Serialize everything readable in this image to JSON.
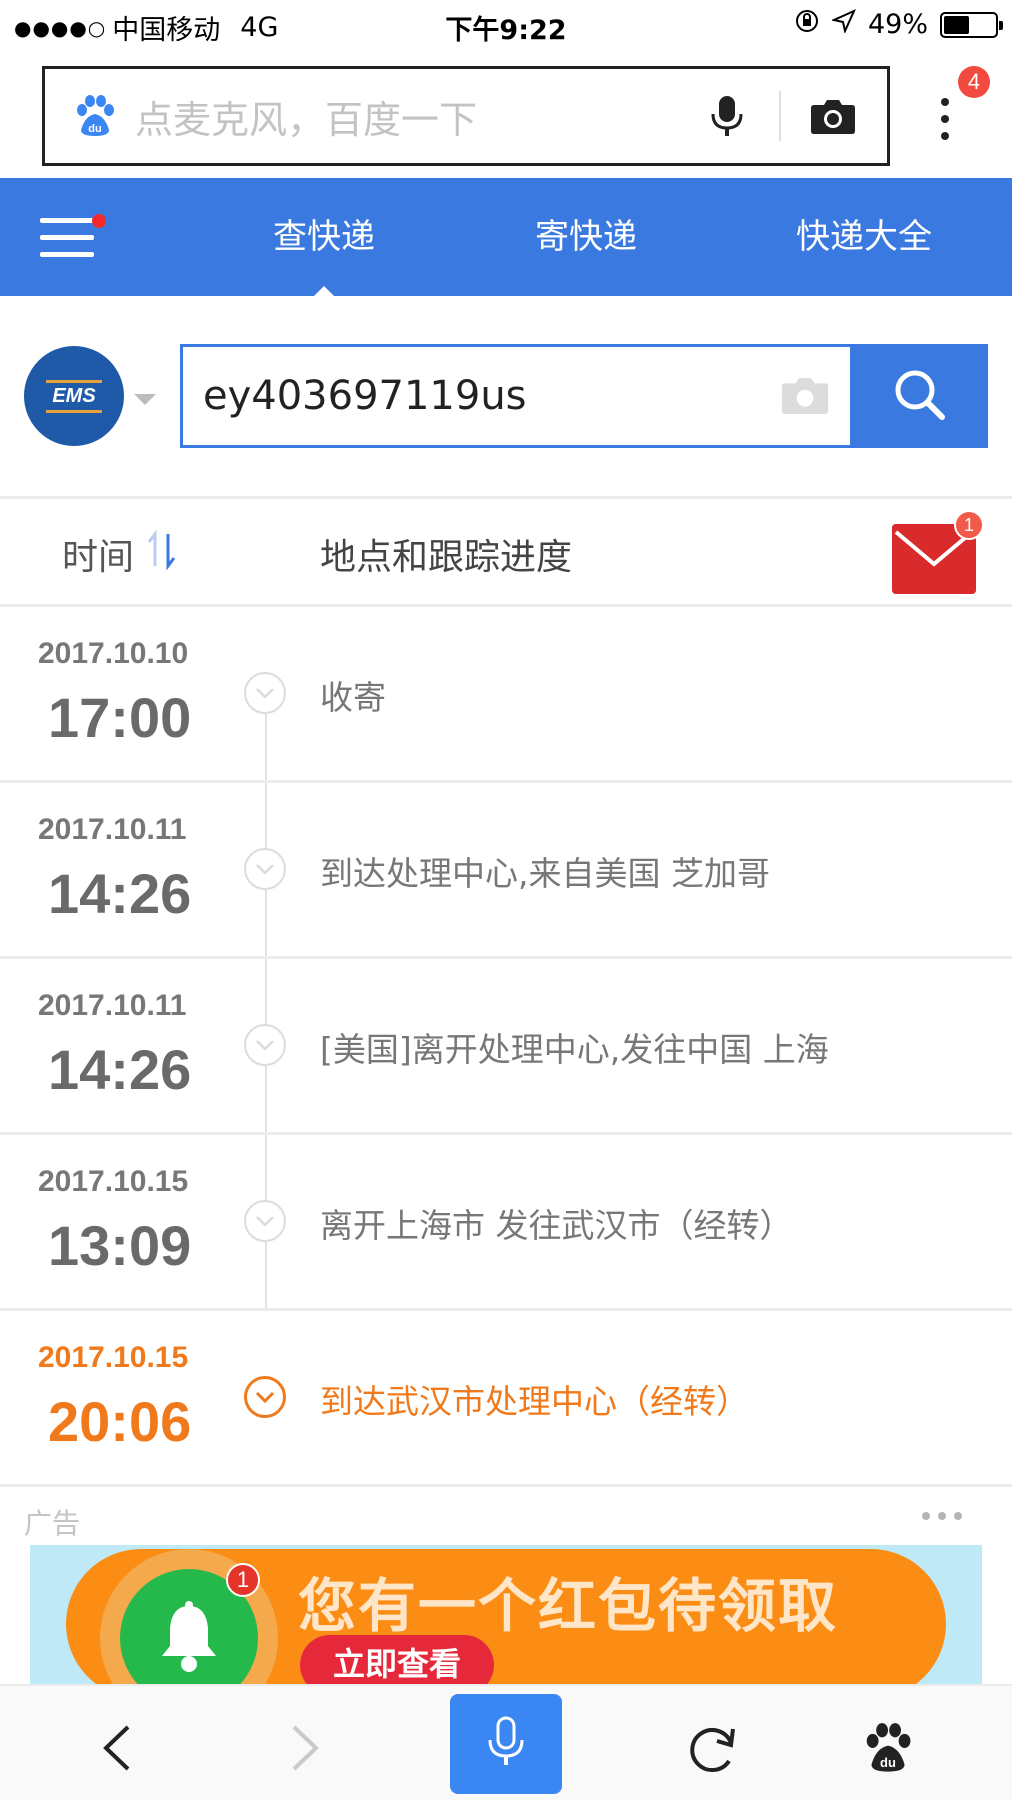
{
  "status_bar": {
    "signal": "●●●●○",
    "carrier": "中国移动",
    "network": "4G",
    "time": "下午9:22",
    "battery_text": "49%",
    "battery_level": 0.49
  },
  "baidu_bar": {
    "placeholder": "点麦克风，百度一下",
    "notification_count": "4",
    "icons": [
      "baidu-paw-icon",
      "microphone-icon",
      "camera-icon",
      "more-vertical-icon"
    ]
  },
  "nav": {
    "tabs": [
      {
        "label": "查快递",
        "active": true
      },
      {
        "label": "寄快递",
        "active": false
      },
      {
        "label": "快递大全",
        "active": false
      }
    ],
    "accent_color": "#3a7ae0"
  },
  "query": {
    "carrier_logo_text": "EMS",
    "tracking_number": "ey403697119us"
  },
  "table_header": {
    "time_label": "时间",
    "location_label": "地点和跟踪进度",
    "message_count": "1"
  },
  "events": [
    {
      "date": "2017.10.10",
      "time": "17:00",
      "desc": "收寄"
    },
    {
      "date": "2017.10.11",
      "time": "14:26",
      "desc": "到达处理中心,来自美国 芝加哥"
    },
    {
      "date": "2017.10.11",
      "time": "14:26",
      "desc": "[美国]离开处理中心,发往中国 上海"
    },
    {
      "date": "2017.10.15",
      "time": "13:09",
      "desc": "离开上海市 发往武汉市（经转）"
    },
    {
      "date": "2017.10.15",
      "time": "20:06",
      "desc": "到达武汉市处理中心（经转）"
    }
  ],
  "current_color": "#f07a1b",
  "ad": {
    "label": "广告",
    "title": "您有一个红包待领取",
    "button": "立即查看",
    "badge": "1"
  }
}
